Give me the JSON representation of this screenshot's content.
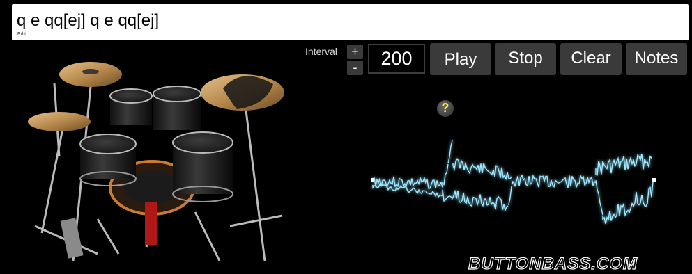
{
  "pattern": {
    "value": "q e qq[ej] q e qq[ej]",
    "edit_label": "Edit"
  },
  "controls": {
    "interval_label": "Interval",
    "plus": "+",
    "minus": "-",
    "interval_value": "200",
    "play": "Play",
    "stop": "Stop",
    "clear": "Clear",
    "notes": "Notes"
  },
  "help": {
    "symbol": "?"
  },
  "branding": {
    "logo": "BUTTONBASS.COM"
  },
  "colors": {
    "background": "#000000",
    "button": "#3a3a3a",
    "waveform": "#9fe8ff",
    "help_mark": "#ffe640"
  }
}
